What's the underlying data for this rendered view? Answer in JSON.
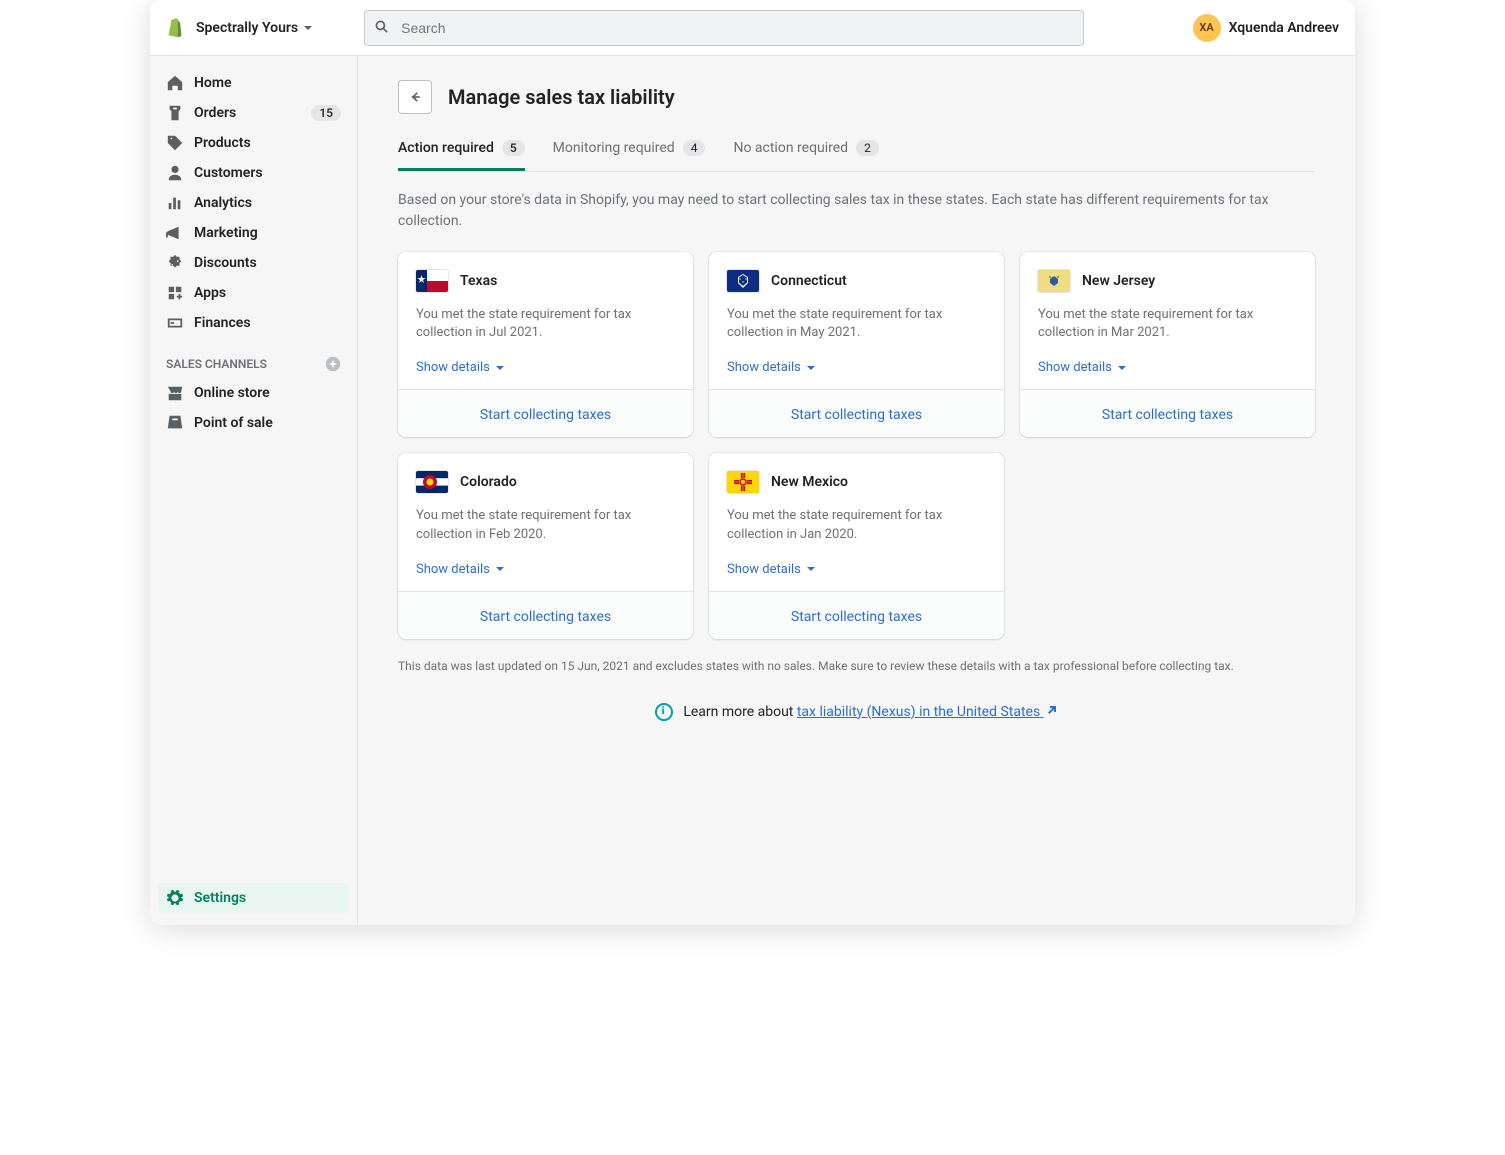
{
  "store_name": "Spectrally Yours",
  "search_placeholder": "Search",
  "user": {
    "initials": "XA",
    "name": "Xquenda Andreev"
  },
  "nav": {
    "items": [
      {
        "label": "Home"
      },
      {
        "label": "Orders",
        "badge": "15"
      },
      {
        "label": "Products"
      },
      {
        "label": "Customers"
      },
      {
        "label": "Analytics"
      },
      {
        "label": "Marketing"
      },
      {
        "label": "Discounts"
      },
      {
        "label": "Apps"
      },
      {
        "label": "Finances"
      }
    ],
    "channels_heading": "SALES CHANNELS",
    "channels": [
      {
        "label": "Online store"
      },
      {
        "label": "Point of sale"
      }
    ],
    "settings": "Settings"
  },
  "page": {
    "title": "Manage sales tax liability",
    "tabs": [
      {
        "label": "Action required",
        "count": "5"
      },
      {
        "label": "Monitoring required",
        "count": "4"
      },
      {
        "label": "No action required",
        "count": "2"
      }
    ],
    "description": "Based on your store's data in Shopify, you may need to start collecting sales tax in these states. Each state has different requirements for tax collection.",
    "show_details": "Show details",
    "start_cta": "Start collecting taxes",
    "states": [
      {
        "name": "Texas",
        "text": "You met the state requirement for tax collection in Jul 2021."
      },
      {
        "name": "Connecticut",
        "text": "You met the state requirement for tax collection in May 2021."
      },
      {
        "name": "New Jersey",
        "text": "You met the state requirement for tax collection in Mar 2021."
      },
      {
        "name": "Colorado",
        "text": "You met the state requirement for tax collection in Feb 2020."
      },
      {
        "name": "New Mexico",
        "text": "You met the state requirement for tax collection in Jan 2020."
      }
    ],
    "footnote": "This data was last updated on 15 Jun, 2021 and excludes states with no sales. Make sure to review these details with a tax professional before collecting tax.",
    "learn_more_prefix": "Learn more about ",
    "learn_more_link": "tax liability (Nexus) in the United States"
  }
}
